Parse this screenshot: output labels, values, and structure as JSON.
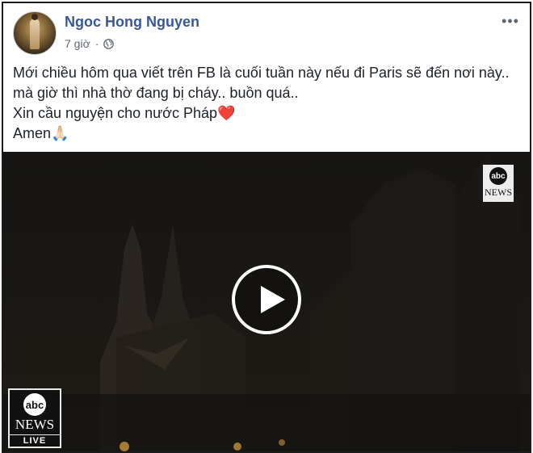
{
  "post": {
    "author": "Ngoc Hong Nguyen",
    "time": "7 giờ",
    "separator": "·",
    "privacy_icon": "globe-icon",
    "more_icon": "more-options-icon",
    "more_label": "•••",
    "lines": [
      "Mới chiều hôm qua viết trên FB là cuối tuần này nếu đi Paris sẽ đến nơi này.. mà giờ thì nhà thờ đang bị cháy.. buồn quá..",
      "Xin cầu nguyện cho nước Pháp",
      "Amen"
    ],
    "line2_emoji": "❤️",
    "line3_emoji": "🙏🏻"
  },
  "video": {
    "watermark_logo": "abc",
    "watermark_text": "NEWS",
    "badge_logo": "abc",
    "badge_text": "NEWS",
    "badge_live": "LIVE",
    "play_icon": "play-icon"
  },
  "colors": {
    "author": "#385898",
    "text": "#1d2129",
    "meta": "#616770",
    "heart": "#e0245e"
  }
}
